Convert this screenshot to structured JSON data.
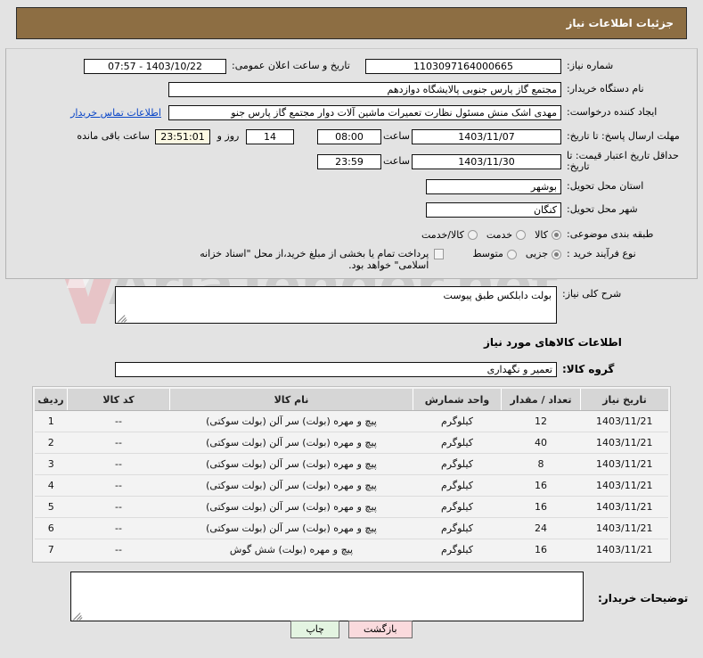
{
  "header": {
    "title": "جزئیات اطلاعات نیاز",
    "bg_color": "#8d6e43"
  },
  "form": {
    "need_number_label": "شماره نیاز:",
    "need_number_value": "1103097164000665",
    "announce_datetime_label": "تاریخ و ساعت اعلان عمومی:",
    "announce_datetime_value": "1403/10/22 - 07:57",
    "buyer_org_label": "نام دستگاه خریدار:",
    "buyer_org_value": "مجتمع گاز پارس جنوبی  پالایشگاه دوازدهم",
    "creator_label": "ایجاد کننده درخواست:",
    "creator_value": "مهدی اشک منش مسئول نظارت تعمیرات ماشین آلات دوار مجتمع گاز پارس جنو",
    "buyer_contact_link": "اطلاعات تماس خریدار",
    "response_deadline_label": "مهلت ارسال پاسخ: تا تاریخ:",
    "response_deadline_date": "1403/11/07",
    "hour_label": "ساعت",
    "response_deadline_time": "08:00",
    "remaining_days": "14",
    "remaining_days_sep": "روز و",
    "remaining_time": "23:51:01",
    "remaining_suffix": "ساعت باقی مانده",
    "price_validity_label": "حداقل تاریخ اعتبار قیمت: تا تاریخ:",
    "price_validity_date": "1403/11/30",
    "price_validity_time": "23:59",
    "province_label": "استان محل تحویل:",
    "province_value": "بوشهر",
    "city_label": "شهر محل تحویل:",
    "city_value": "کنگان",
    "classification_label": "طبقه بندی موضوعی:",
    "classification_options": [
      {
        "label": "کالا",
        "selected": true
      },
      {
        "label": "خدمت",
        "selected": false
      },
      {
        "label": "کالا/خدمت",
        "selected": false
      }
    ],
    "process_type_label": "نوع فرآیند خرید :",
    "process_type_options": [
      {
        "label": "جزیی",
        "selected": true
      },
      {
        "label": "متوسط",
        "selected": false
      }
    ],
    "treasury_checkbox_label": "پرداخت تمام یا بخشی از مبلغ خرید،از محل \"اسناد خزانه اسلامی\" خواهد بود.",
    "treasury_checked": false
  },
  "description": {
    "label": "شرح کلی نیاز:",
    "value": "بولت دابلکس طبق پیوست"
  },
  "goods_section": {
    "heading": "اطلاعات کالاهای مورد نیاز",
    "group_label": "گروه کالا:",
    "group_value": "تعمیر و نگهداری"
  },
  "items_table": {
    "columns": [
      "ردیف",
      "کد کالا",
      "نام کالا",
      "واحد شمارش",
      "تعداد / مقدار",
      "تاریخ نیاز"
    ],
    "rows": [
      {
        "radif": "1",
        "code": "--",
        "name": "پیچ و مهره (بولت) سر آلن (بولت سوکتی)",
        "unit": "کیلوگرم",
        "qty": "12",
        "date": "1403/11/21"
      },
      {
        "radif": "2",
        "code": "--",
        "name": "پیچ و مهره (بولت) سر آلن (بولت سوکتی)",
        "unit": "کیلوگرم",
        "qty": "40",
        "date": "1403/11/21"
      },
      {
        "radif": "3",
        "code": "--",
        "name": "پیچ و مهره (بولت) سر آلن (بولت سوکتی)",
        "unit": "کیلوگرم",
        "qty": "8",
        "date": "1403/11/21"
      },
      {
        "radif": "4",
        "code": "--",
        "name": "پیچ و مهره (بولت) سر آلن (بولت سوکتی)",
        "unit": "کیلوگرم",
        "qty": "16",
        "date": "1403/11/21"
      },
      {
        "radif": "5",
        "code": "--",
        "name": "پیچ و مهره (بولت) سر آلن (بولت سوکتی)",
        "unit": "کیلوگرم",
        "qty": "16",
        "date": "1403/11/21"
      },
      {
        "radif": "6",
        "code": "--",
        "name": "پیچ و مهره (بولت) سر آلن (بولت سوکتی)",
        "unit": "کیلوگرم",
        "qty": "24",
        "date": "1403/11/21"
      },
      {
        "radif": "7",
        "code": "--",
        "name": "پیچ و مهره (بولت) شش گوش",
        "unit": "کیلوگرم",
        "qty": "16",
        "date": "1403/11/21"
      }
    ]
  },
  "buyer_notes": {
    "label": "توضیحات خریدار:",
    "value": ""
  },
  "footer": {
    "back_label": "بازگشت",
    "print_label": "چاپ"
  },
  "watermark": {
    "text": "AriaTender.net"
  }
}
